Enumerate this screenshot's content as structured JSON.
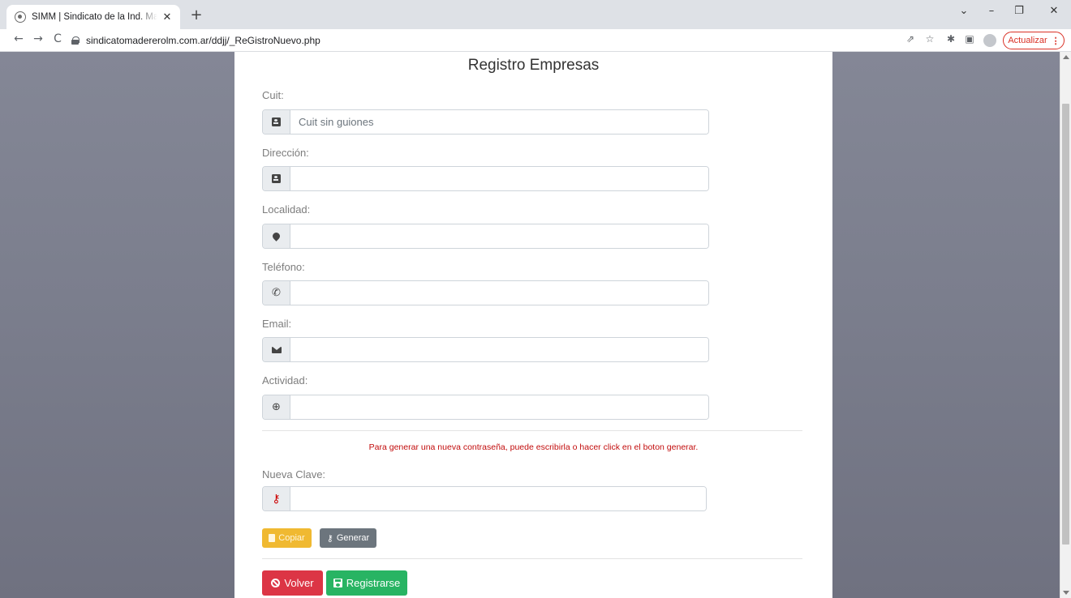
{
  "browser": {
    "tab_title": "SIMM | Sindicato de la Ind. Made",
    "tab_close": "✕",
    "new_tab": "+",
    "url": "sindicatomadererolm.com.ar/ddjj/_ReGistroNuevo.php",
    "update_label": "Actualizar",
    "update_menu": "⋮",
    "window_controls": {
      "dropdown": "⌄",
      "minimize": "–",
      "restore": "❐",
      "close": "✕"
    },
    "nav": {
      "back": "←",
      "forward": "→",
      "reload": "C"
    },
    "toolbar_icons": {
      "share": "⇗",
      "star": "☆",
      "extensions": "✱",
      "sidepanel": "▣"
    }
  },
  "form": {
    "title": "Registro Empresas",
    "fields": {
      "cuit": {
        "label": "Cuit:",
        "placeholder": "Cuit sin guiones",
        "value": "",
        "icon": "address-card-icon"
      },
      "direccion": {
        "label": "Dirección:",
        "placeholder": "",
        "value": "",
        "icon": "address-card-icon"
      },
      "localidad": {
        "label": "Localidad:",
        "placeholder": "",
        "value": "",
        "icon": "map-marker-icon"
      },
      "telefono": {
        "label": "Teléfono:",
        "placeholder": "",
        "value": "",
        "icon": "phone-icon",
        "glyph": "✆"
      },
      "email": {
        "label": "Email:",
        "placeholder": "",
        "value": "",
        "icon": "envelope-icon"
      },
      "actividad": {
        "label": "Actividad:",
        "placeholder": "",
        "value": "",
        "icon": "globe-icon",
        "glyph": "⊕"
      }
    },
    "password_hint": "Para generar una nueva contraseña, puede escribirla o hacer click en el boton generar.",
    "new_password": {
      "label": "Nueva Clave:",
      "placeholder": "",
      "value": "",
      "icon": "key-icon",
      "glyph": "⚷"
    },
    "buttons": {
      "copy": "Copiar",
      "generate": "Generar",
      "generate_glyph": "⚷",
      "back": "Volver",
      "register": "Registrarse"
    }
  },
  "colors": {
    "hint": "#c20c0c",
    "copy": "#f0b931",
    "generate": "#6c757d",
    "back": "#dc3545",
    "register": "#28b463",
    "update": "#d93025"
  }
}
